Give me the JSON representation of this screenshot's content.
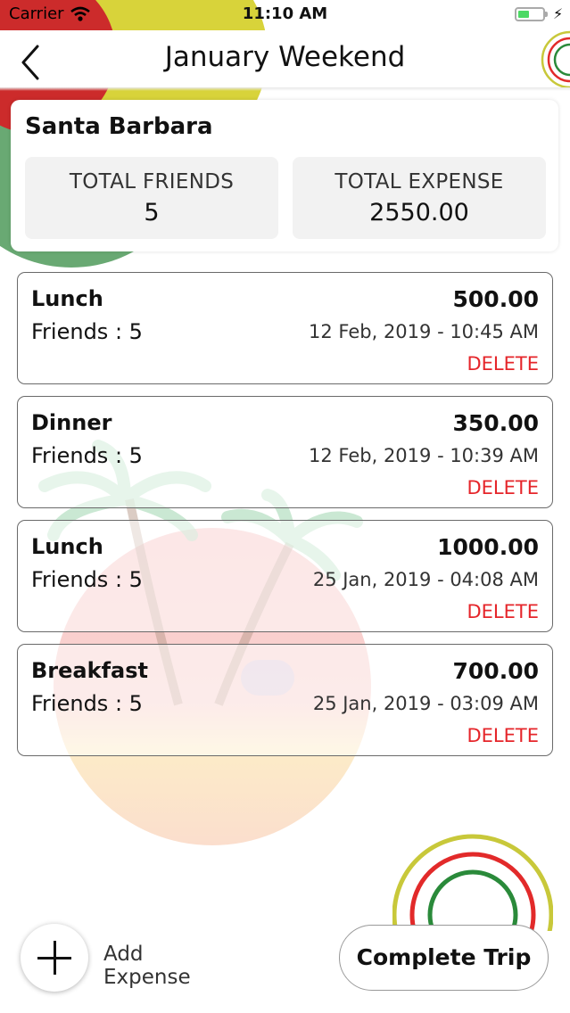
{
  "status_bar": {
    "carrier": "Carrier",
    "time": "11:10 AM",
    "battery_level": 0.45
  },
  "nav": {
    "title": "January Weekend"
  },
  "summary": {
    "trip_name": "Santa Barbara",
    "total_friends_label": "TOTAL FRIENDS",
    "total_friends_value": "5",
    "total_expense_label": "TOTAL EXPENSE",
    "total_expense_value": "2550.00"
  },
  "expenses": [
    {
      "title": "Lunch",
      "friends": "Friends : 5",
      "amount": "500.00",
      "date": "12 Feb, 2019 - 10:45 AM",
      "delete_label": "DELETE"
    },
    {
      "title": "Dinner",
      "friends": "Friends : 5",
      "amount": "350.00",
      "date": "12 Feb, 2019 - 10:39 AM",
      "delete_label": "DELETE"
    },
    {
      "title": "Lunch",
      "friends": "Friends : 5",
      "amount": "1000.00",
      "date": "25 Jan, 2019 - 04:08 AM",
      "delete_label": "DELETE"
    },
    {
      "title": "Breakfast",
      "friends": "Friends : 5",
      "amount": "700.00",
      "date": "25 Jan, 2019 - 03:09 AM",
      "delete_label": "DELETE"
    }
  ],
  "footer": {
    "add_label": "Add Expense",
    "complete_label": "Complete Trip"
  },
  "colors": {
    "accent_red": "#e5252a",
    "ring_yellow": "#c8c83a",
    "ring_red": "#e22a2a",
    "ring_green": "#2a8a3a"
  }
}
